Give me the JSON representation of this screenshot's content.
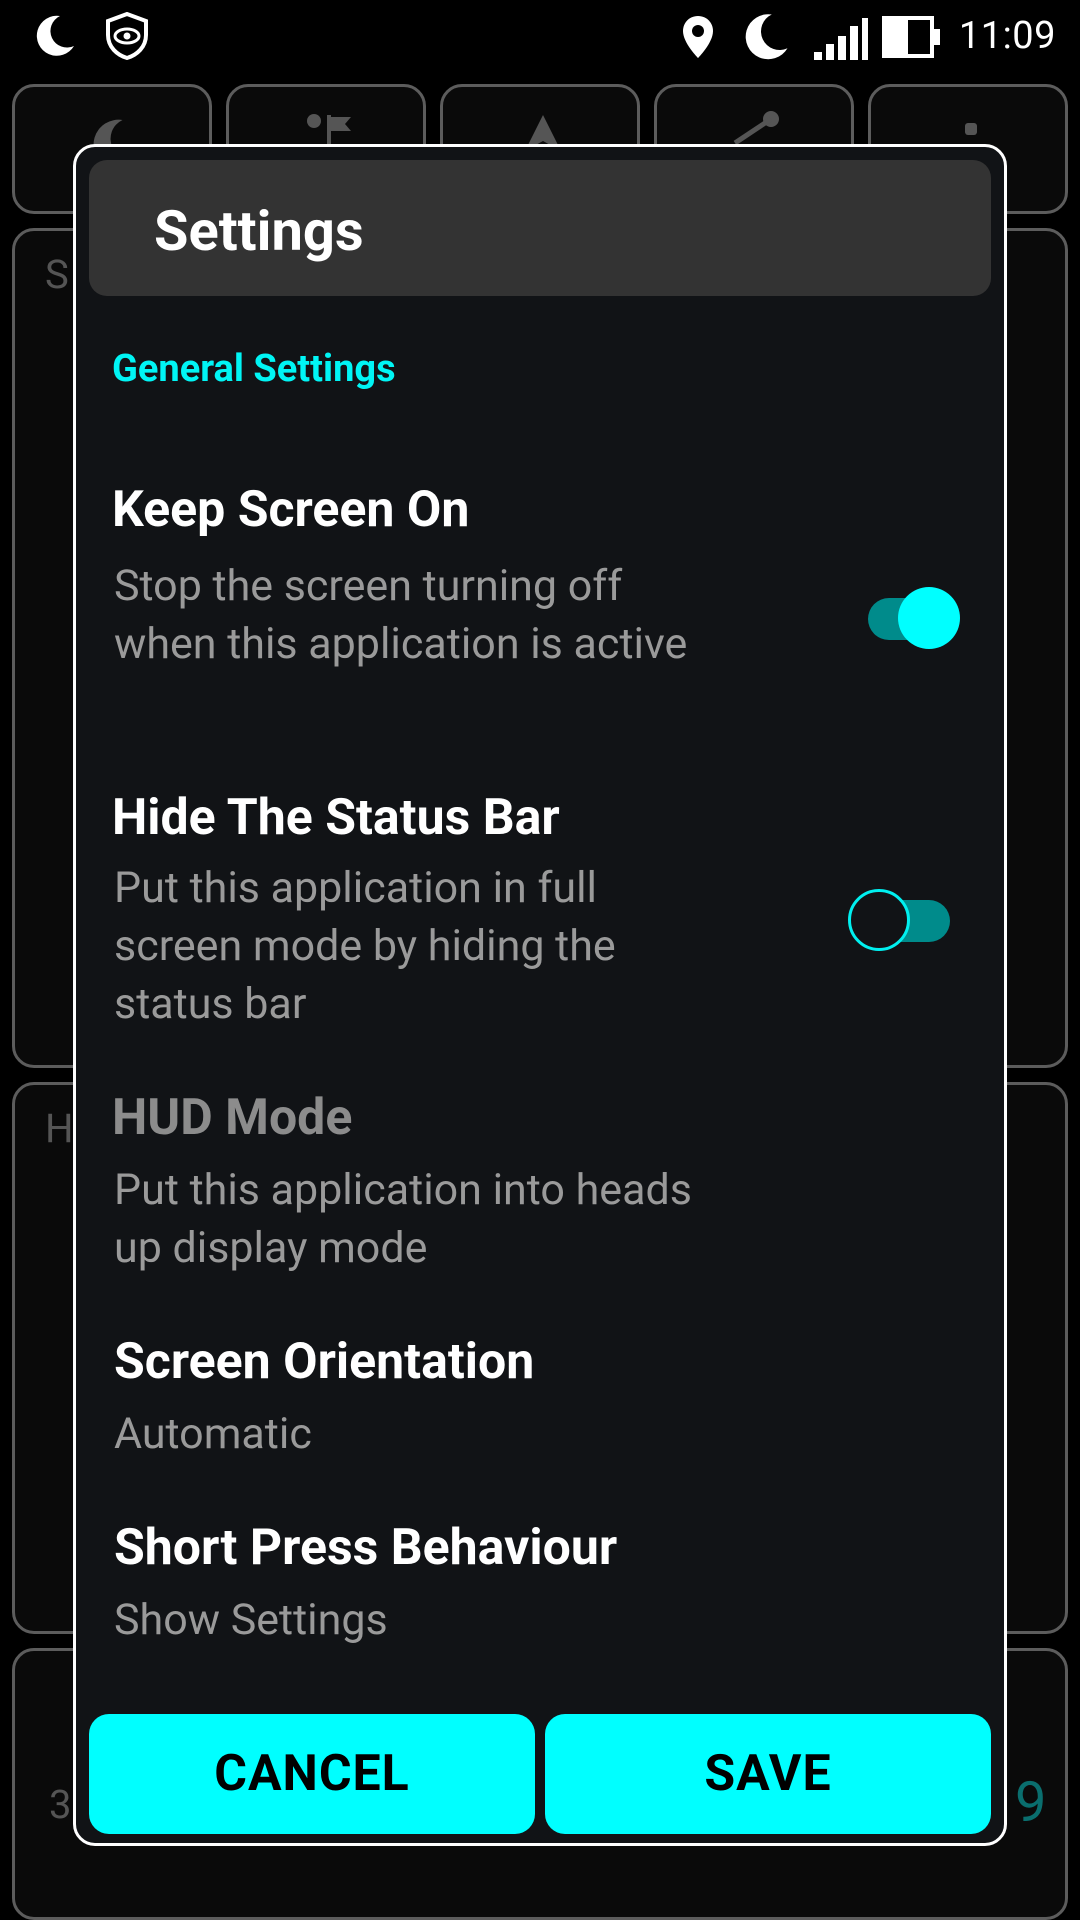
{
  "status_bar": {
    "time": "11:09",
    "left_icons": [
      "moon-icon",
      "shield-eye-icon"
    ],
    "right_icons": [
      "location-icon",
      "moon-icon",
      "signal-icon",
      "battery-icon"
    ]
  },
  "background": {
    "left_labels": [
      "S",
      "H",
      "3"
    ],
    "right_digit": "9"
  },
  "dialog": {
    "title": "Settings",
    "section": "General Settings",
    "prefs": [
      {
        "title": "Keep Screen On",
        "summary": "Stop the screen turning off when this application is active",
        "toggle": true
      },
      {
        "title": "Hide The Status Bar",
        "summary": "Put this application in full screen mode by hiding the status bar",
        "toggle": false
      },
      {
        "title": "HUD Mode",
        "summary": "Put this application into heads up display mode",
        "disabled": true
      },
      {
        "title": "Screen Orientation",
        "summary": "Automatic"
      },
      {
        "title": "Short Press Behaviour",
        "summary": "Show Settings"
      }
    ],
    "cancel_label": "CANCEL",
    "save_label": "SAVE"
  },
  "colors": {
    "accent": "#00ffff",
    "accent_dark": "#008b8b",
    "dialog_bg": "#111316",
    "header_bg": "#333333"
  }
}
